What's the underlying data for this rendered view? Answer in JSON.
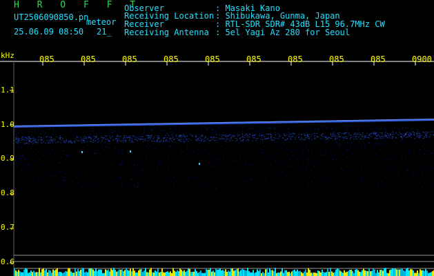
{
  "header": {
    "title": "H R O F F T",
    "filename": "UT2506090850.pn",
    "type": "meteor",
    "datetime": "25.06.09 08:50",
    "count": "21_",
    "info": [
      {
        "key": "Observer",
        "value": ": Masaki Kano"
      },
      {
        "key": "Receiving Location",
        "value": ": Shibukawa, Gunma, Japan"
      },
      {
        "key": "Receiver",
        "value": ": RTL-SDR SDR# 43dB L15 96.7MHz CW"
      },
      {
        "key": "Receiving Antenna",
        "value": ": 5el Yagi Az 280 for Seoul"
      }
    ]
  },
  "axis": {
    "unit": "kHz",
    "y_labels": [
      "1.1",
      "1.0",
      "0.9",
      "0.8",
      "0.7",
      "0.6"
    ],
    "time_labels": [
      "085",
      "085",
      "085",
      "085",
      "085",
      "085",
      "085",
      "085",
      "085",
      "0900"
    ]
  },
  "chart_data": {
    "type": "heatmap",
    "ylabel": "kHz",
    "ylim": [
      0.6,
      1.1
    ],
    "carrier_line_khz": [
      0.995,
      1.015
    ],
    "colors": {
      "axis_text": "#ffff00",
      "header_text": "#20e0ff",
      "title": "#22e04a",
      "signal": "#3a6cff"
    }
  }
}
